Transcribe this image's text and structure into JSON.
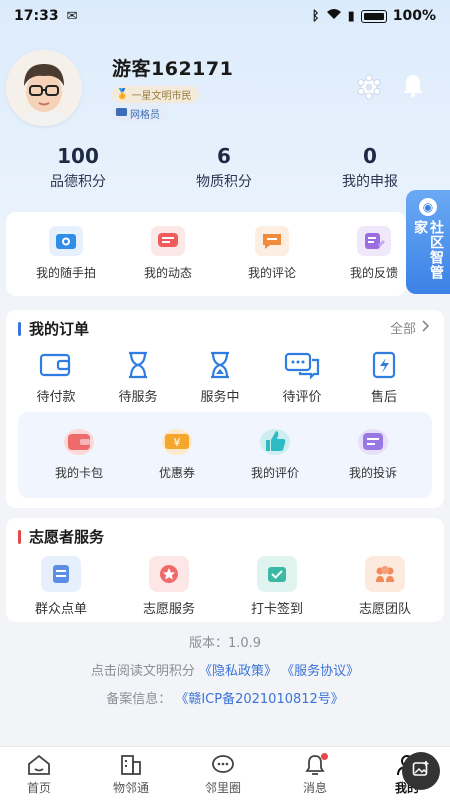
{
  "status_bar": {
    "time": "17:33",
    "battery": "100%"
  },
  "profile": {
    "username": "游客162171",
    "badge_civil": "一星文明市民",
    "badge_grid": "网格员"
  },
  "stats": [
    {
      "value": "100",
      "label": "品德积分"
    },
    {
      "value": "6",
      "label": "物质积分"
    },
    {
      "value": "0",
      "label": "我的申报"
    }
  ],
  "side_tab": {
    "label": "社区智管家"
  },
  "quick_actions": [
    {
      "label": "我的随手拍",
      "icon": "camera-icon",
      "color": "#2f8ee8"
    },
    {
      "label": "我的动态",
      "icon": "message-icon",
      "color": "#ef5a5a"
    },
    {
      "label": "我的评论",
      "icon": "comment-icon",
      "color": "#f08a3c"
    },
    {
      "label": "我的反馈",
      "icon": "feedback-icon",
      "color": "#9a6ee0"
    }
  ],
  "orders": {
    "title": "我的订单",
    "all_label": "全部",
    "items": [
      {
        "label": "待付款",
        "icon": "wallet-icon"
      },
      {
        "label": "待服务",
        "icon": "hourglass-icon"
      },
      {
        "label": "服务中",
        "icon": "hourglass-filled-icon"
      },
      {
        "label": "待评价",
        "icon": "chat-icon"
      },
      {
        "label": "售后",
        "icon": "aftersale-icon"
      }
    ],
    "sub_items": [
      {
        "label": "我的卡包",
        "icon": "card-wallet-icon"
      },
      {
        "label": "优惠券",
        "icon": "coupon-icon"
      },
      {
        "label": "我的评价",
        "icon": "thumbs-up-icon"
      },
      {
        "label": "我的投诉",
        "icon": "complaint-icon"
      }
    ]
  },
  "volunteer": {
    "title": "志愿者服务",
    "items": [
      {
        "label": "群众点单",
        "icon": "order-list-icon"
      },
      {
        "label": "志愿服务",
        "icon": "star-icon"
      },
      {
        "label": "打卡签到",
        "icon": "checkin-icon"
      },
      {
        "label": "志愿团队",
        "icon": "team-icon"
      }
    ]
  },
  "footer": {
    "version": "版本：1.0.9",
    "agreement_prefix": "点击阅读文明积分",
    "privacy": "《隐私政策》",
    "service": "《服务协议》",
    "record_prefix": "备案信息：",
    "record": "《赣ICP备2021010812号》"
  },
  "tabbar": [
    {
      "label": "首页",
      "icon": "home-icon"
    },
    {
      "label": "物邻通",
      "icon": "building-icon"
    },
    {
      "label": "邻里圈",
      "icon": "chat-bubble-icon"
    },
    {
      "label": "消息",
      "icon": "bell-icon"
    },
    {
      "label": "我的",
      "icon": "user-icon"
    }
  ],
  "colors": {
    "accent": "#3b73d8",
    "orders_bar": "#3b73d8",
    "volunteer_bar": "#e54848"
  }
}
